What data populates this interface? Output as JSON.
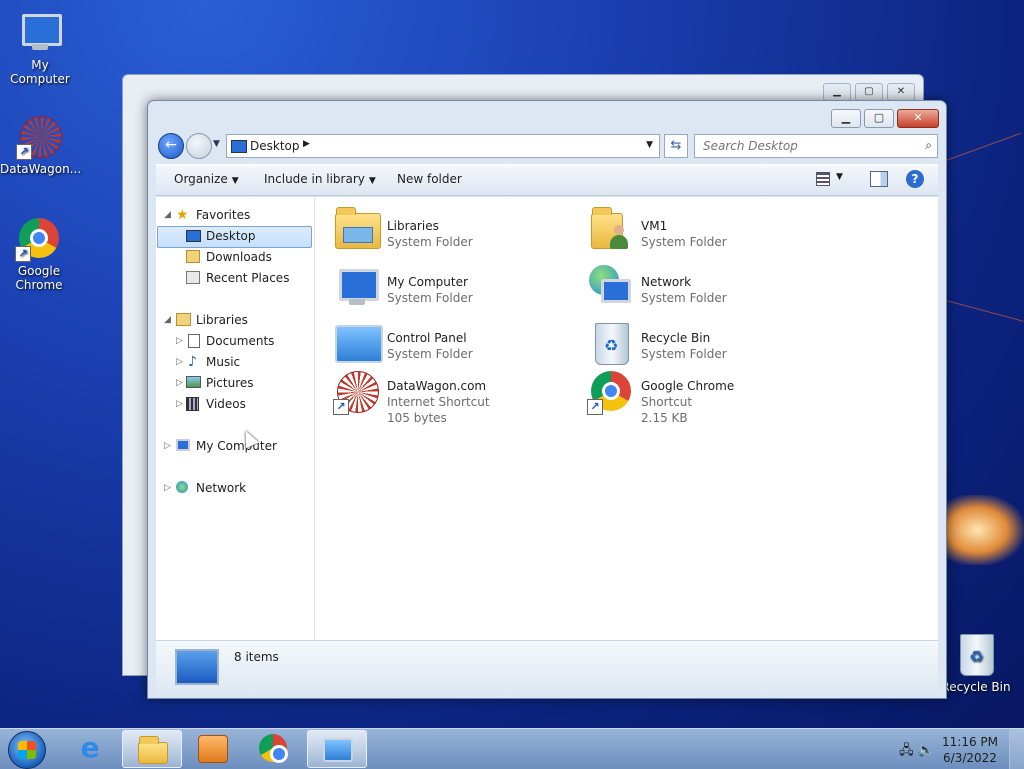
{
  "desktop": {
    "icons": [
      {
        "label": "My Computer"
      },
      {
        "label": "DataWagon..."
      },
      {
        "label": "Google Chrome"
      },
      {
        "label": "Recycle Bin"
      }
    ]
  },
  "window": {
    "address": {
      "crumb": "Desktop",
      "search_placeholder": "Search Desktop"
    },
    "toolbar": {
      "organize": "Organize",
      "include": "Include in library",
      "new_folder": "New folder"
    },
    "nav": {
      "favorites": "Favorites",
      "desktop": "Desktop",
      "downloads": "Downloads",
      "recent": "Recent Places",
      "libraries": "Libraries",
      "documents": "Documents",
      "music": "Music",
      "pictures": "Pictures",
      "videos": "Videos",
      "my_computer": "My Computer",
      "network": "Network"
    },
    "items": [
      {
        "name": "Libraries",
        "type": "System Folder"
      },
      {
        "name": "VM1",
        "type": "System Folder"
      },
      {
        "name": "My Computer",
        "type": "System Folder"
      },
      {
        "name": "Network",
        "type": "System Folder"
      },
      {
        "name": "Control Panel",
        "type": "System Folder"
      },
      {
        "name": "Recycle Bin",
        "type": "System Folder"
      },
      {
        "name": "DataWagon.com",
        "type": "Internet Shortcut",
        "size": "105 bytes"
      },
      {
        "name": "Google Chrome",
        "type": "Shortcut",
        "size": "2.15 KB"
      }
    ],
    "status": {
      "count": "8 items"
    }
  },
  "taskbar": {
    "time": "11:16 PM",
    "date": "6/3/2022"
  },
  "colors": {
    "accent": "#2d6bd1",
    "selection": "#c4e0fc",
    "desktop": "#1a3fb0"
  }
}
